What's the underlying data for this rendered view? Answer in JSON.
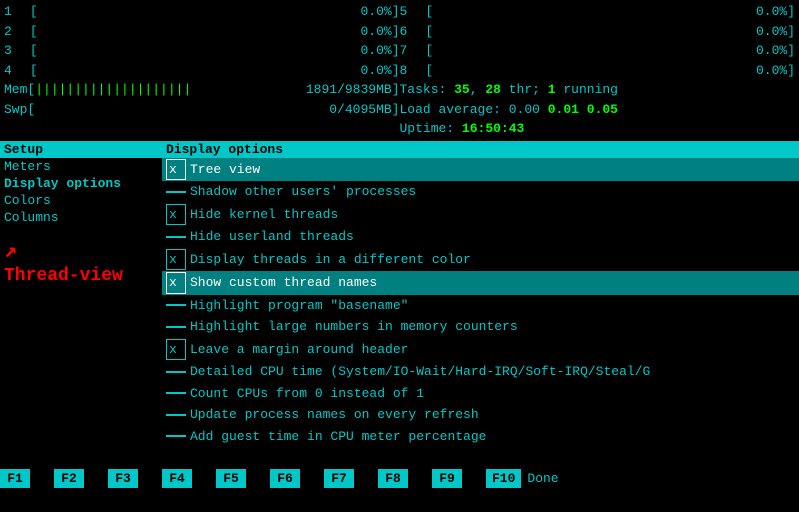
{
  "header": {
    "cpus_left": [
      {
        "num": "1",
        "bar": "[",
        "pct": "0.0%]"
      },
      {
        "num": "2",
        "bar": "[",
        "pct": "0.0%]"
      },
      {
        "num": "3",
        "bar": "[",
        "pct": "0.0%]"
      },
      {
        "num": "4",
        "bar": "[",
        "pct": "0.0%]"
      }
    ],
    "cpus_right": [
      {
        "num": "5",
        "bar": "[",
        "pct": "0.0%]"
      },
      {
        "num": "6",
        "bar": "[",
        "pct": "0.0%]"
      },
      {
        "num": "7",
        "bar": "[",
        "pct": "0.0%]"
      },
      {
        "num": "8",
        "bar": "[",
        "pct": "0.0%]"
      }
    ],
    "mem_label": "Mem[",
    "mem_bar": "||||||||||||||||||||",
    "mem_val": "1891/9839MB]",
    "swp_label": "Swp[",
    "swp_bar": "",
    "swp_val": "0/4095MB]",
    "tasks_label": "Tasks:",
    "tasks_val": "35",
    "thr_val": "28",
    "thr_label": "thr;",
    "running_val": "1",
    "running_label": "running",
    "load_label": "Load average:",
    "load_vals": "0.00  0.01  0.05",
    "uptime_label": "Uptime:",
    "uptime_val": "16:50:43"
  },
  "sidebar": {
    "header": "Setup",
    "items": [
      {
        "label": "Meters",
        "active": false
      },
      {
        "label": "Display options",
        "active": true
      },
      {
        "label": "Colors",
        "active": false
      },
      {
        "label": "Columns",
        "active": false
      }
    ],
    "arrow_text": "➜",
    "thread_view_label": "Thread-view"
  },
  "content": {
    "header": "Display options",
    "options": [
      {
        "checked": true,
        "label": "Tree view",
        "highlighted": true
      },
      {
        "checked": false,
        "label": "Shadow other users' processes",
        "highlighted": false
      },
      {
        "checked": true,
        "label": "Hide kernel threads",
        "highlighted": false
      },
      {
        "checked": false,
        "label": "Hide userland threads",
        "highlighted": false
      },
      {
        "checked": true,
        "label": "Display threads in a different color",
        "highlighted": false
      },
      {
        "checked": true,
        "label": "Show custom thread names",
        "highlighted": true
      },
      {
        "checked": false,
        "label": "Highlight program \"basename\"",
        "highlighted": false
      },
      {
        "checked": false,
        "label": "Highlight large numbers in memory counters",
        "highlighted": false
      },
      {
        "checked": true,
        "label": "Leave a margin around header",
        "highlighted": false
      },
      {
        "checked": false,
        "label": "Detailed CPU time (System/IO-Wait/Hard-IRQ/Soft-IRQ/Steal/G",
        "highlighted": false
      },
      {
        "checked": false,
        "label": "Count CPUs from 0 instead of 1",
        "highlighted": false
      },
      {
        "checked": false,
        "label": "Update process names on every refresh",
        "highlighted": false
      },
      {
        "checked": false,
        "label": "Add guest time in CPU meter percentage",
        "highlighted": false
      }
    ]
  },
  "footer": {
    "keys": [
      "F1",
      "F2",
      "F3",
      "F4",
      "F5",
      "F6",
      "F7",
      "F8",
      "F9",
      "F10"
    ],
    "labels": [
      "",
      "",
      "",
      "",
      "",
      "",
      "",
      "",
      "",
      "Done"
    ]
  }
}
